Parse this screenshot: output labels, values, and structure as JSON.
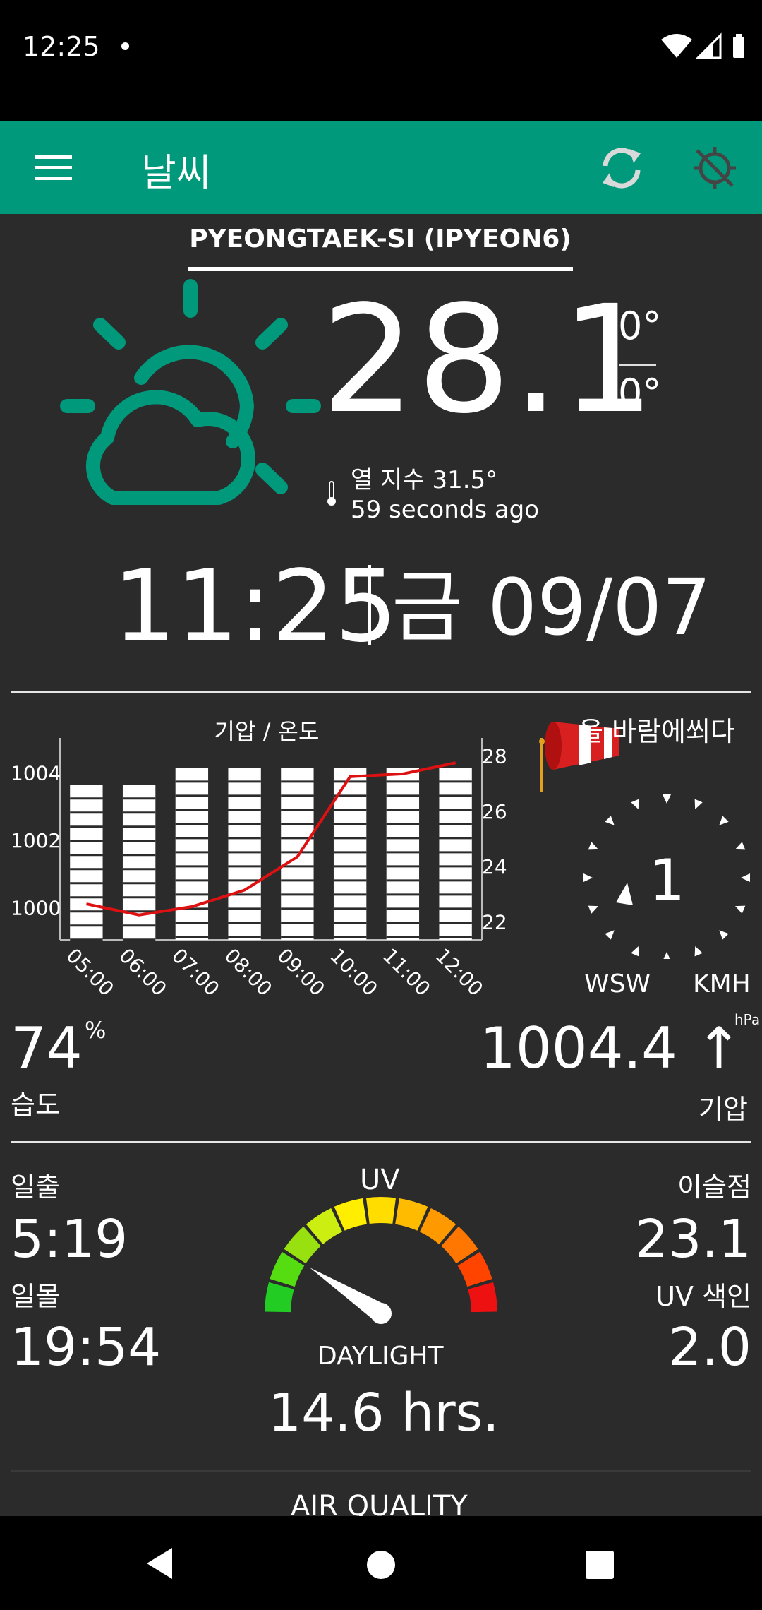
{
  "status_bar": {
    "time": "12:25",
    "icons": [
      "dot-icon",
      "wifi-icon",
      "signal-icon",
      "battery-icon"
    ]
  },
  "app_bar": {
    "title": "날씨",
    "background": "#00997b",
    "icons": [
      "menu-icon",
      "refresh-icon",
      "location-off-icon"
    ]
  },
  "station": {
    "name": "PYEONGTAEK-SI (IPYEON6)"
  },
  "current": {
    "condition_icon": "partly-cloudy-icon",
    "temperature": "28.1",
    "high": "0°",
    "low": "0°",
    "heat_index": "열 지수 31.5°",
    "updated": "59 seconds ago"
  },
  "clock": {
    "time": "11:25",
    "date": "금 09/07"
  },
  "chart_data": {
    "type": "bar",
    "title": "기압 / 온도",
    "categories": [
      "05:00",
      "06:00",
      "07:00",
      "08:00",
      "09:00",
      "10:00",
      "11:00",
      "12:00"
    ],
    "series": [
      {
        "type": "bar",
        "values": [
          1003.6,
          1003.6,
          1004.1,
          1004.1,
          1004.1,
          1004.1,
          1004.1,
          1004.1
        ]
      },
      {
        "type": "line",
        "values": [
          22.6,
          22.2,
          22.5,
          23.1,
          24.3,
          27.2,
          27.3,
          27.7
        ]
      }
    ],
    "y_left": {
      "ticks": [
        "1000",
        "1002",
        "1004"
      ],
      "range": [
        999,
        1005
      ]
    },
    "y_right": {
      "ticks": [
        "22",
        "24",
        "26",
        "28"
      ],
      "range": [
        21.3,
        28.6
      ]
    },
    "colors": {
      "bar": "#ffffff",
      "line": "#dd1111"
    }
  },
  "wind": {
    "label": "을 바람에쐬다",
    "speed": "1",
    "direction": "WSW",
    "unit": "KMH",
    "icon": "windsock-icon"
  },
  "humidity": {
    "value": "74",
    "unit": "%",
    "label": "습도"
  },
  "pressure": {
    "value": "1004.4 ↑",
    "unit": "hPa",
    "label": "기압"
  },
  "sun": {
    "sunrise_label": "일출",
    "sunrise": "5:19",
    "sunset_label": "일몰",
    "sunset": "19:54"
  },
  "dew_point": {
    "label": "이슬점",
    "value": "23.1"
  },
  "uv_index": {
    "label": "UV 색인",
    "value": "2.0"
  },
  "uv_gauge": {
    "title": "UV",
    "level": 2.0,
    "max": 11
  },
  "daylight": {
    "label": "DAYLIGHT",
    "value": "14.6 hrs."
  },
  "air_quality": {
    "title": "AIR QUALITY"
  },
  "nav_bar": {
    "icons": [
      "back-icon",
      "home-icon",
      "recents-icon"
    ]
  }
}
